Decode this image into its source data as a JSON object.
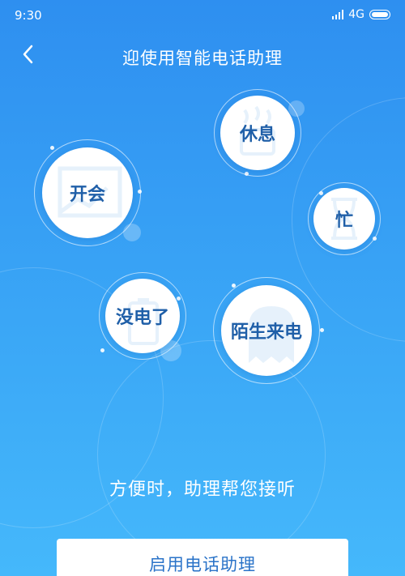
{
  "status_bar": {
    "time": "9:30",
    "network": "4G"
  },
  "header": {
    "title": "迎使用智能电话助理"
  },
  "scenes": [
    {
      "label": "开会"
    },
    {
      "label": "休息"
    },
    {
      "label": "忙"
    },
    {
      "label": "没电了"
    },
    {
      "label": "陌生来电"
    }
  ],
  "tagline": "方便时，助理帮您接听",
  "cta": {
    "label": "启用电话助理"
  },
  "colors": {
    "bg_top": "#2e8ff0",
    "bg_bottom": "#45b8fb",
    "bubble_text": "#1f5fa8",
    "button_text": "#2a73c8"
  }
}
